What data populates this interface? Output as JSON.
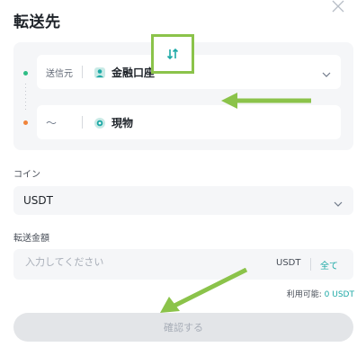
{
  "header": {
    "title": "転送先"
  },
  "transfer": {
    "from": {
      "label": "送信元",
      "account": "金融口座",
      "icon": "finance-account-icon"
    },
    "to": {
      "label": "～",
      "account": "現物",
      "icon": "spot-wallet-icon"
    },
    "swap_icon": "swap-arrows-icon"
  },
  "coin": {
    "label": "コイン",
    "selected": "USDT"
  },
  "amount": {
    "label": "転送金額",
    "placeholder": "入力してください",
    "unit": "USDT",
    "all_label": "全て"
  },
  "available": {
    "label": "利用可能:",
    "value": "0 USDT"
  },
  "confirm_button": {
    "label": "確認する"
  },
  "colors": {
    "accent": "#1ea9a6",
    "green": "#2ebd85",
    "orange": "#f0833a",
    "highlight": "#8bc34a"
  }
}
